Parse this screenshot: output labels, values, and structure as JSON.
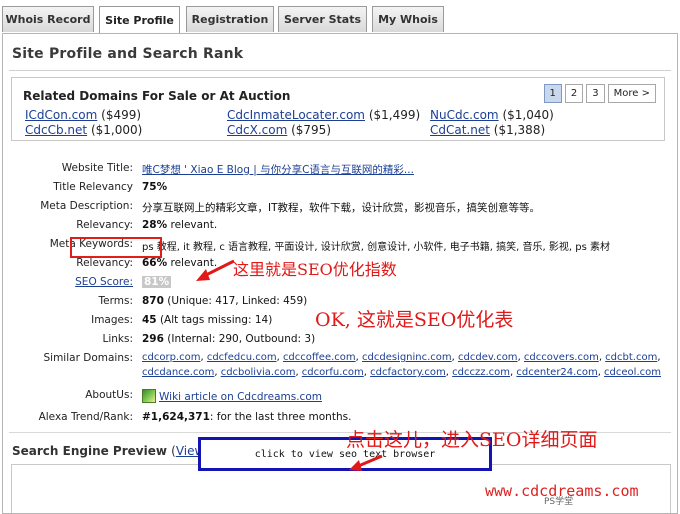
{
  "tabs": [
    {
      "label": "Whois Record",
      "active": false
    },
    {
      "label": "Site Profile",
      "active": true
    },
    {
      "label": "Registration",
      "active": false
    },
    {
      "label": "Server Stats",
      "active": false
    },
    {
      "label": "My Whois",
      "active": false
    }
  ],
  "panel_title": "Site Profile and Search Rank",
  "related_domains": {
    "title": "Related Domains For Sale or At Auction",
    "pager": [
      "1",
      "2",
      "3",
      "More >"
    ],
    "active_page": "1",
    "domains": [
      {
        "name": "ICdCon.com",
        "price": "($499)"
      },
      {
        "name": "CdcInmateLocater.com",
        "price": "($1,499)"
      },
      {
        "name": "NuCdc.com",
        "price": "($1,040)"
      },
      {
        "name": "CdcCb.net",
        "price": "($1,000)"
      },
      {
        "name": "CdcX.com",
        "price": "($795)"
      },
      {
        "name": "CdCat.net",
        "price": "($1,388)"
      }
    ]
  },
  "profile": {
    "website_title": {
      "label": "Website Title:",
      "value": "唯C梦想 ' Xiao E Blog | 与你分享C语言与互联网的精彩..."
    },
    "title_relevancy": {
      "label": "Title Relevancy",
      "value": "75%"
    },
    "meta_description": {
      "label": "Meta Description:",
      "value": "分享互联网上的精彩文章，IT教程，软件下载，设计欣赏，影视音乐，搞笑创意等等。"
    },
    "desc_relevancy": {
      "label": "Relevancy:",
      "value": "28%",
      "suffix": " relevant."
    },
    "meta_keywords": {
      "label": "Meta Keywords:",
      "value": "ps 教程, it 教程, c 语言教程, 平面设计, 设计欣赏, 创意设计, 小软件, 电子书籍, 搞笑, 音乐, 影视, ps 素材"
    },
    "kw_relevancy": {
      "label": "Relevancy:",
      "value": "66%",
      "suffix": " relevant."
    },
    "seo_score": {
      "label": "SEO Score:",
      "value": "81%"
    },
    "terms": {
      "label": "Terms:",
      "value": "870",
      "suffix": " (Unique: 417, Linked: 459)"
    },
    "images": {
      "label": "Images:",
      "value": "45",
      "suffix": " (Alt tags missing: 14)"
    },
    "links": {
      "label": "Links:",
      "value": "296",
      "suffix": " (Internal: 290, Outbound: 3)"
    },
    "similar_domains": {
      "label": "Similar Domains:",
      "line1": [
        "cdcorp.com",
        "cdcfedcu.com",
        "cdccoffee.com",
        "cdcdesigninc.com",
        "cdcdev.com",
        "cdccovers.com",
        "cdcbt.com"
      ],
      "line2": [
        "cdcdance.com",
        "cdcbolivia.com",
        "cdcorfu.com",
        "cdcfactory.com",
        "cdcczz.com",
        "cdcenter24.com",
        "cdceol.com"
      ]
    },
    "about_us": {
      "label": "AboutUs:",
      "value": "Wiki article on Cdcdreams.com"
    },
    "alexa": {
      "label": "Alexa Trend/Rank:",
      "value": "#1,624,371",
      "suffix": ": for the last three months."
    }
  },
  "preview": {
    "title": "Search Engine Preview",
    "link": "View details",
    "browser_button": "click to view seo text browser"
  },
  "annotations": {
    "seo_index": "这里就是SEO优化指数",
    "seo_table": "OK, 这就是SEO优化表",
    "click_here": "点击这儿，进入SEO详细页面"
  },
  "watermark": "www.cdcdreams.com",
  "watermark_small": "PS学堂",
  "colors": {
    "annotation": "#e01818",
    "highlight_box": "#1414b4",
    "link": "#1c3f94"
  }
}
